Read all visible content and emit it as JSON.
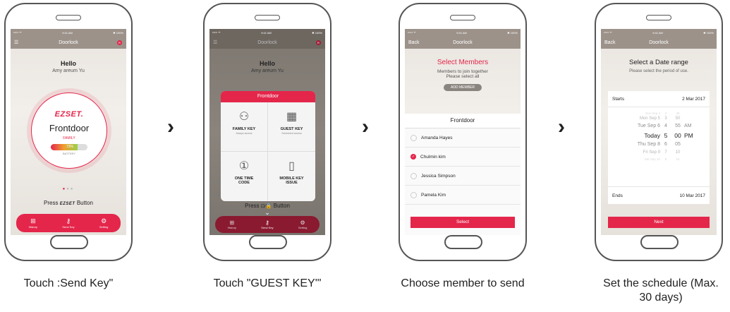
{
  "colors": {
    "accent": "#e4264b",
    "header": "#9c928a"
  },
  "arrow_glyph": "›",
  "status": {
    "carrier": "••••• ᯤ",
    "time": "9:41 AM",
    "battery": "✱ 100%"
  },
  "screen1": {
    "title": "Doorlock",
    "menu_icon": "hamburger-icon",
    "greeting": "Hello",
    "user": "Amy areum Yu",
    "brand": "EZSET.",
    "door": "Frontdoor",
    "role": "FAMILY",
    "battery_pct": "73%",
    "battery_level": 0.73,
    "battery_label": "BATTERY",
    "press_prefix": "Press",
    "press_logo": "EZSET",
    "press_suffix": "Button",
    "tabs": [
      {
        "icon": "history-icon",
        "label": "History"
      },
      {
        "icon": "send-key-icon",
        "label": "Send Key"
      },
      {
        "icon": "setting-icon",
        "label": "Setting"
      }
    ]
  },
  "screen2": {
    "title": "Doorlock",
    "greeting": "Hello",
    "user": "Amy areum Yu",
    "popup_title": "Frontdoor",
    "options": [
      {
        "icon": "family-key-icon",
        "label": "FAMILY KEY",
        "sub": "Always access"
      },
      {
        "icon": "guest-key-icon",
        "label": "GUEST KEY",
        "sub": "Scheduled access"
      },
      {
        "icon": "one-time-code-icon",
        "label": "ONE TIME CODE",
        "sub": ""
      },
      {
        "icon": "mobile-key-icon",
        "label": "MOBILE KEY ISSUE",
        "sub": ""
      }
    ],
    "press_prefix": "Press",
    "press_suffix": "Button",
    "tabs": [
      {
        "label": "History"
      },
      {
        "label": "Send Key"
      },
      {
        "label": "Setting"
      }
    ]
  },
  "screen3": {
    "back": "Back",
    "title": "Doorlock",
    "heading": "Select Members",
    "sub1": "Members to join together",
    "sub2": "Please select all",
    "add_member": "ADD MEMBER",
    "group": "Frontdoor",
    "members": [
      {
        "name": "Amanda Hayes",
        "checked": false
      },
      {
        "name": "Chulmin kim",
        "checked": true
      },
      {
        "name": "Jessica Simpson",
        "checked": false
      },
      {
        "name": "Pamela Kim",
        "checked": false
      }
    ],
    "select_button": "Select"
  },
  "screen4": {
    "back": "Back",
    "title": "Doorlock",
    "heading": "Select a Date range",
    "sub": "Please select the period of use.",
    "starts_label": "Starts",
    "starts_value": "2 Mar 2017",
    "picker_rows": [
      {
        "day": "Sun Sep 4",
        "hour": "2",
        "min": "45",
        "ampm": ""
      },
      {
        "day": "Mon Sep 5",
        "hour": "3",
        "min": "50",
        "ampm": ""
      },
      {
        "day": "Tue Sep 6",
        "hour": "4",
        "min": "55",
        "ampm": "AM"
      },
      {
        "day": "Today",
        "hour": "5",
        "min": "00",
        "ampm": "PM"
      },
      {
        "day": "Thu Sep 8",
        "hour": "6",
        "min": "05",
        "ampm": ""
      },
      {
        "day": "Fri Sep 9",
        "hour": "7",
        "min": "10",
        "ampm": ""
      },
      {
        "day": "Sat Sep 10",
        "hour": "8",
        "min": "15",
        "ampm": ""
      }
    ],
    "ends_label": "Ends",
    "ends_value": "10 Mar 2017",
    "next_button": "Next"
  },
  "captions": [
    "Touch :Send Key\"",
    "Touch \"GUEST KEY'\"",
    "Choose member to send",
    "Set the schedule (Max. 30 days)"
  ]
}
